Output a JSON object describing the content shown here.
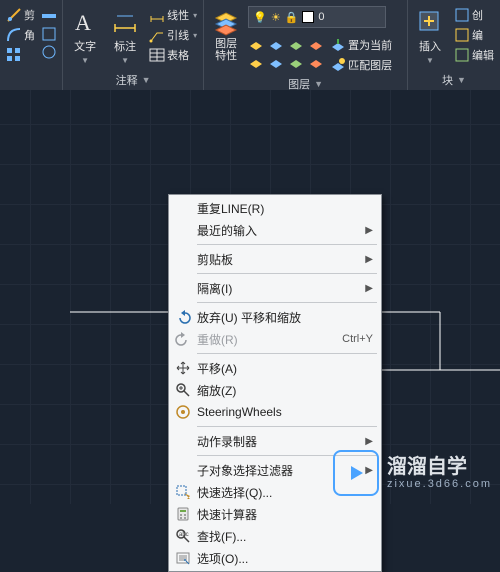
{
  "ribbon": {
    "panel_edit": {
      "btn1": "剪",
      "btn2": "角",
      "title": ""
    },
    "panel_annot": {
      "text_btn": "文字",
      "dim_btn": "标注",
      "line_style": "线性",
      "leader": "引线",
      "table": "表格",
      "title": "注释"
    },
    "panel_layer": {
      "prop_btn": "图层\n特性",
      "current": "0",
      "set_current": "置为当前",
      "match": "匹配图层",
      "title": "图层"
    },
    "panel_block": {
      "insert_btn": "插入",
      "edit": "编",
      "create": "创",
      "edit_attr": "编辑",
      "title": "块"
    }
  },
  "context_menu": {
    "items": [
      {
        "label": "重复LINE(R)",
        "icon": "",
        "sub": ""
      },
      {
        "label": "最近的输入",
        "icon": "",
        "sub": "▶"
      },
      {
        "sep": true
      },
      {
        "label": "剪贴板",
        "icon": "",
        "sub": "▶"
      },
      {
        "sep": true
      },
      {
        "label": "隔离(I)",
        "icon": "",
        "sub": "▶"
      },
      {
        "sep": true
      },
      {
        "label": "放弃(U) 平移和缩放",
        "icon": "undo",
        "sub": ""
      },
      {
        "label": "重做(R)",
        "icon": "redo",
        "sub": "",
        "shortcut": "Ctrl+Y",
        "disabled": true
      },
      {
        "sep": true
      },
      {
        "label": "平移(A)",
        "icon": "pan",
        "sub": ""
      },
      {
        "label": "缩放(Z)",
        "icon": "zoom",
        "sub": ""
      },
      {
        "label": "SteeringWheels",
        "icon": "wheel",
        "sub": ""
      },
      {
        "sep": true
      },
      {
        "label": "动作录制器",
        "icon": "",
        "sub": "▶"
      },
      {
        "sep": true
      },
      {
        "label": "子对象选择过滤器",
        "icon": "",
        "sub": "▶"
      },
      {
        "label": "快速选择(Q)...",
        "icon": "qselect",
        "sub": ""
      },
      {
        "label": "快速计算器",
        "icon": "calc",
        "sub": ""
      },
      {
        "label": "查找(F)...",
        "icon": "find",
        "sub": ""
      },
      {
        "label": "选项(O)...",
        "icon": "options",
        "sub": ""
      }
    ]
  },
  "watermark": {
    "brand": "溜溜自学",
    "url": "zixue.3d66.com"
  }
}
